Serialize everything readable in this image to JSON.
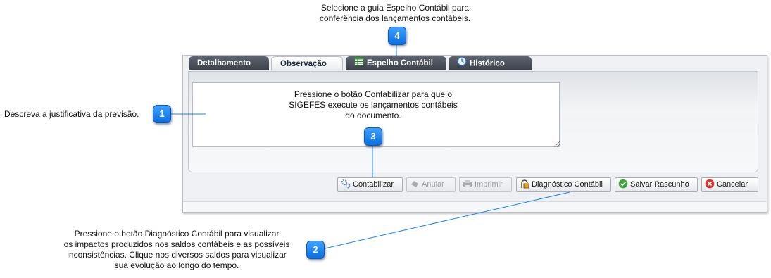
{
  "callouts": {
    "c1": {
      "number": "1",
      "text": "Descreva a justificativa da previsão."
    },
    "c2": {
      "number": "2",
      "lines": [
        "Pressione o botão Diagnóstico Contábil para visualizar",
        "os impactos produzidos nos saldos contábeis e as possíveis",
        "inconsistências. Clique nos diversos saldos para visualizar",
        "sua evolução ao longo do tempo."
      ]
    },
    "c3": {
      "number": "3",
      "lines": [
        "Pressione o botão Contabilizar para que o",
        "SIGEFES execute os lançamentos contábeis",
        "do documento."
      ]
    },
    "c4": {
      "number": "4",
      "lines": [
        "Selecione a guia Espelho Contábil para",
        "conferência dos lançamentos contábeis."
      ]
    }
  },
  "tabs": [
    {
      "label": "Detalhamento",
      "active": false,
      "icon": null
    },
    {
      "label": "Observação",
      "active": true,
      "icon": null
    },
    {
      "label": "Espelho Contábil",
      "active": false,
      "icon": "spreadsheet-icon"
    },
    {
      "label": "Histórico",
      "active": false,
      "icon": "history-clock-icon"
    }
  ],
  "observacao": {
    "value": ""
  },
  "buttons": {
    "contabilizar": {
      "label": "Contabilizar",
      "enabled": true
    },
    "anular": {
      "label": "Anular",
      "enabled": false
    },
    "imprimir": {
      "label": "Imprimir",
      "enabled": false
    },
    "diagnostico": {
      "label": "Diagnóstico Contábil",
      "enabled": true
    },
    "salvar": {
      "label": "Salvar Rascunho",
      "enabled": true
    },
    "cancelar": {
      "label": "Cancelar",
      "enabled": true
    }
  },
  "colors": {
    "callout": "#1a82f0",
    "tab_dark": "#4a4f58",
    "panel": "#eef0f3"
  }
}
